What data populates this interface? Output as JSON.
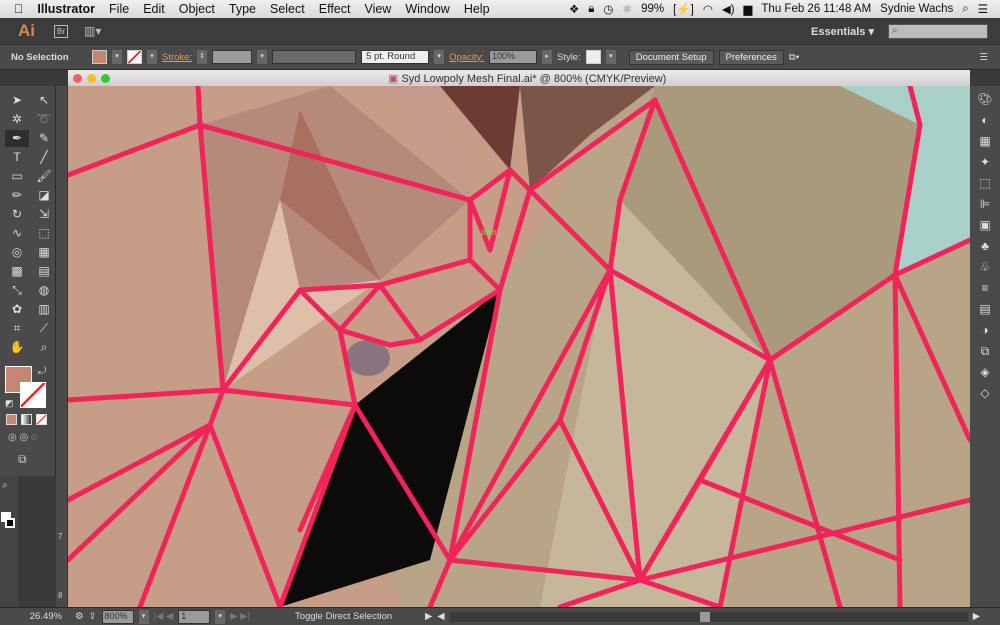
{
  "menubar": {
    "app": "Illustrator",
    "items": [
      "File",
      "Edit",
      "Object",
      "Type",
      "Select",
      "Effect",
      "View",
      "Window",
      "Help"
    ],
    "battery": "99%",
    "datetime": "Thu Feb 26  11:48 AM",
    "user": "Sydnie Wachs"
  },
  "appbar": {
    "logo": "Ai",
    "bridge": "Br",
    "workspace": "Essentials"
  },
  "control": {
    "selection": "No Selection",
    "fill_color": "#c58572",
    "stroke_label": "Stroke:",
    "brush": "5 pt. Round",
    "opacity_label": "Opacity:",
    "opacity": "100%",
    "style_label": "Style:",
    "document_setup": "Document Setup",
    "preferences": "Preferences"
  },
  "document": {
    "title": "Syd Lowpoly Mesh Final.ai* @ 800% (CMYK/Preview)",
    "cursor_hint": "path"
  },
  "tools": [
    {
      "name": "selection-tool",
      "g": "➤"
    },
    {
      "name": "direct-selection-tool",
      "g": "↖"
    },
    {
      "name": "magic-wand-tool",
      "g": "✲"
    },
    {
      "name": "lasso-tool",
      "g": "➰"
    },
    {
      "name": "pen-tool",
      "g": "✒"
    },
    {
      "name": "anchor-point-tool",
      "g": "✎"
    },
    {
      "name": "type-tool",
      "g": "T"
    },
    {
      "name": "line-tool",
      "g": "╱"
    },
    {
      "name": "rectangle-tool",
      "g": "▭"
    },
    {
      "name": "paintbrush-tool",
      "g": "🖌"
    },
    {
      "name": "pencil-tool",
      "g": "✏"
    },
    {
      "name": "eraser-tool",
      "g": "◪"
    },
    {
      "name": "rotate-tool",
      "g": "↻"
    },
    {
      "name": "scale-tool",
      "g": "⇲"
    },
    {
      "name": "warp-tool",
      "g": "∿"
    },
    {
      "name": "free-transform-tool",
      "g": "⬚"
    },
    {
      "name": "shape-builder-tool",
      "g": "◎"
    },
    {
      "name": "perspective-grid-tool",
      "g": "▦"
    },
    {
      "name": "mesh-tool",
      "g": "▩"
    },
    {
      "name": "gradient-tool",
      "g": "▤"
    },
    {
      "name": "eyedropper-tool",
      "g": "⤡"
    },
    {
      "name": "blend-tool",
      "g": "◍"
    },
    {
      "name": "symbol-sprayer-tool",
      "g": "✿"
    },
    {
      "name": "column-graph-tool",
      "g": "▥"
    },
    {
      "name": "artboard-tool",
      "g": "⌗"
    },
    {
      "name": "slice-tool",
      "g": "⟋"
    },
    {
      "name": "hand-tool",
      "g": "✋"
    },
    {
      "name": "zoom-tool",
      "g": "⌕"
    }
  ],
  "ruler": {
    "marks": [
      "7",
      "8"
    ]
  },
  "status": {
    "zoom_readout": "26.49%",
    "zoom": "800%",
    "artboard": "1",
    "tool_hint": "Toggle Direct Selection"
  },
  "colors": {
    "accent_stroke": "#f0245a",
    "orange_label": "#e8964c"
  }
}
